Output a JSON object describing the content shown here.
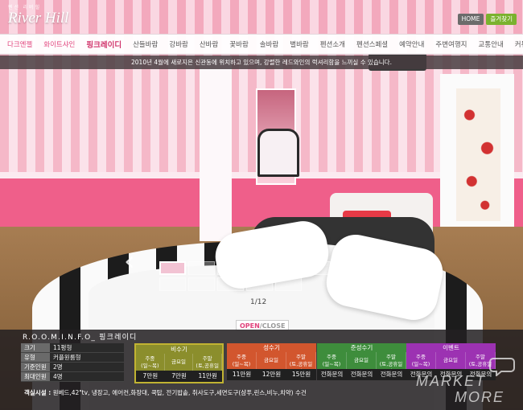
{
  "brand": {
    "sub": "펜션 리버힐",
    "name": "River Hill"
  },
  "top_buttons": {
    "home": "HOME",
    "favorite": "즐겨찾기"
  },
  "nav": [
    "다크엔젤",
    "화이트샤인",
    "핑크레이디",
    "산들바람",
    "강바람",
    "산바람",
    "꽃바람",
    "솔바람",
    "별바람",
    "펜션소개",
    "펜션스페셜",
    "예약안내",
    "주변여행지",
    "교통안내",
    "커뮤니티"
  ],
  "notice": "2010년 4월에 새로지은 신관동에 위치하고 있으며, 강렬한 레드와인의 럭셔리함을 느끼실 수 있습니다.",
  "slider": {
    "counter": "1/12",
    "toggle_open": "OPEN",
    "toggle_sep": "/",
    "toggle_close": "CLOSE"
  },
  "room": {
    "title": "R.O.O.M.I.N.F.O_ 핑크레이디",
    "specs": [
      {
        "key": "크기",
        "value": "11평형"
      },
      {
        "key": "유형",
        "value": "커플원룸형"
      },
      {
        "key": "기준인원",
        "value": "2명"
      },
      {
        "key": "최대인원",
        "value": "4명"
      }
    ],
    "seasons": [
      {
        "name": "비수기",
        "cols": [
          "주중\n(일~목)",
          "금요일",
          "주말\n(토,공휴일전)"
        ],
        "prices": [
          "7만원",
          "7만원",
          "11만원"
        ],
        "color": "#8b8e2c"
      },
      {
        "name": "성수기",
        "cols": [
          "주중\n(일~목)",
          "금요일",
          "주말\n(토,공휴일전)"
        ],
        "prices": [
          "11만원",
          "12만원",
          "15만원"
        ],
        "color": "#d2562e"
      },
      {
        "name": "준성수기",
        "cols": [
          "주중\n(일~목)",
          "금요일",
          "주말\n(토,공휴일전)"
        ],
        "prices": [
          "전화문의",
          "전화문의",
          "전화문의"
        ],
        "color": "#3e8d3c"
      },
      {
        "name": "이벤트",
        "cols": [
          "주중\n(일~목)",
          "금요일",
          "주말\n(토,공휴일전)"
        ],
        "prices": [
          "전화문의",
          "전화문의",
          "전화문의"
        ],
        "color": "#9c32b2"
      }
    ],
    "amenities_label": "객실시설 :",
    "amenities": "원베드,42\"tv, 냉장고, 에어컨,화장대, 쿡탑, 전기밥솥, 취사도구,세면도구(샴푸,린스,비누,치약) 수건"
  },
  "watermark": {
    "line1": "MARKET",
    "line2": "MORE"
  }
}
